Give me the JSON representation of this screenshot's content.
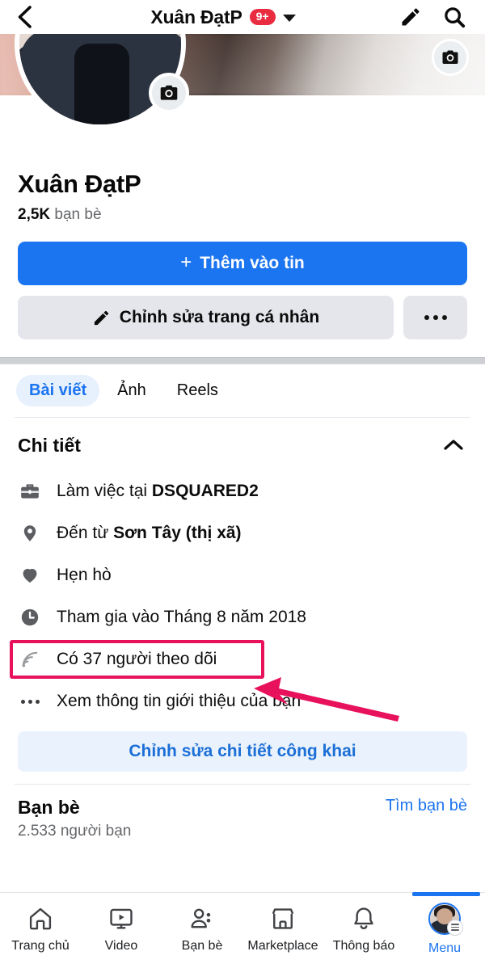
{
  "topbar": {
    "back_icon": "chevron-left-icon",
    "title": "Xuân ĐạtP",
    "badge": "9+",
    "caret_icon": "chevron-down-icon",
    "edit_icon": "pencil-icon",
    "search_icon": "search-icon"
  },
  "cover": {
    "camera_icon": "camera-icon"
  },
  "avatar": {
    "camera_icon": "camera-icon"
  },
  "identity": {
    "name": "Xuân ĐạtP",
    "friends_count": "2,5K",
    "friends_label": "bạn bè"
  },
  "actions": {
    "add_story_label": "Thêm vào tin",
    "add_story_plus": "+",
    "edit_profile_label": "Chỉnh sửa trang cá nhân",
    "edit_profile_icon": "pencil-icon",
    "more_icon": "ellipsis-icon"
  },
  "tabs": [
    {
      "label": "Bài viết",
      "active": true
    },
    {
      "label": "Ảnh",
      "active": false
    },
    {
      "label": "Reels",
      "active": false
    }
  ],
  "details": {
    "section_title": "Chi tiết",
    "collapse_icon": "chevron-up-icon",
    "items": [
      {
        "icon": "briefcase-icon",
        "prefix": "Làm việc tại ",
        "value": "DSQUARED2",
        "highlighted": false
      },
      {
        "icon": "location-pin-icon",
        "prefix": "Đến từ ",
        "value": "Sơn Tây (thị xã)",
        "highlighted": false
      },
      {
        "icon": "heart-icon",
        "prefix": "Hẹn hò",
        "value": "",
        "highlighted": false
      },
      {
        "icon": "clock-icon",
        "prefix": "Tham gia vào Tháng 8 năm 2018",
        "value": "",
        "highlighted": false
      },
      {
        "icon": "rss-followers-icon",
        "prefix": "Có 37 người theo dõi",
        "value": "",
        "highlighted": true
      },
      {
        "icon": "ellipsis-icon",
        "prefix": "Xem thông tin giới thiệu của bạn",
        "value": "",
        "highlighted": false
      }
    ],
    "edit_public_label": "Chỉnh sửa chi tiết công khai"
  },
  "friends": {
    "title": "Bạn bè",
    "subtitle": "2.533 người bạn",
    "find_link": "Tìm bạn bè"
  },
  "bottomnav": [
    {
      "label": "Trang chủ",
      "icon": "home-icon",
      "active": false
    },
    {
      "label": "Video",
      "icon": "video-icon",
      "active": false
    },
    {
      "label": "Bạn bè",
      "icon": "friends-icon",
      "active": false
    },
    {
      "label": "Marketplace",
      "icon": "marketplace-icon",
      "active": false
    },
    {
      "label": "Thông báo",
      "icon": "bell-icon",
      "active": false
    },
    {
      "label": "Menu",
      "icon": "avatar-menu-icon",
      "active": true
    }
  ],
  "annotation": {
    "highlight_color": "#e8125c",
    "arrow_color": "#e8125c",
    "target": "Có 37 người theo dõi"
  },
  "colors": {
    "brand_blue": "#1b74f0",
    "badge_red": "#ea2c40",
    "chip_blue_bg": "#e7f0fd",
    "button_gray": "#e4e6eb",
    "text_secondary": "#65676b"
  }
}
